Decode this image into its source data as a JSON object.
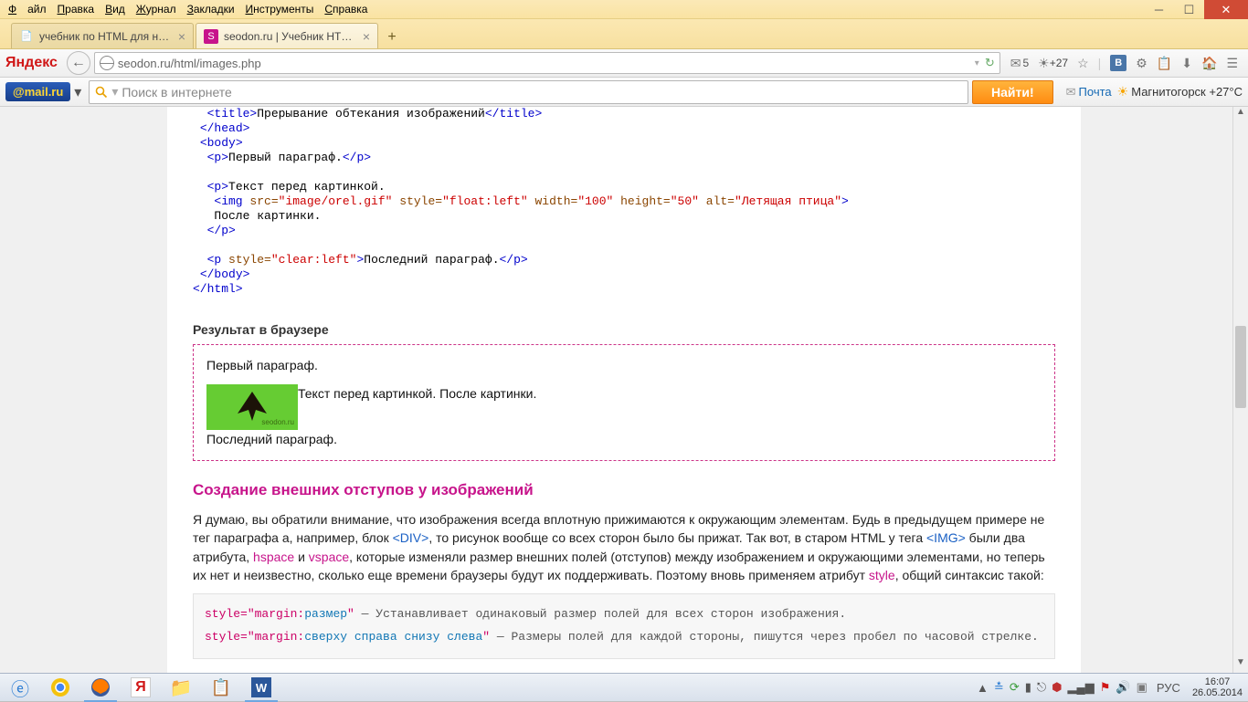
{
  "menu": {
    "file": "Файл",
    "edit": "Правка",
    "view": "Вид",
    "journal": "Журнал",
    "bookmarks": "Закладки",
    "tools": "Инструменты",
    "help": "Справка"
  },
  "tabs": [
    {
      "title": "учебник по HTML для начи...",
      "fav": "📘"
    },
    {
      "title": "seodon.ru | Учебник HTM...",
      "fav": "S"
    }
  ],
  "nav": {
    "yandex": "Яндекс",
    "url": "seodon.ru/html/images.php",
    "mailcount": "5",
    "temp": "+27"
  },
  "mailbar": {
    "logo": "@mail.ru",
    "placeholder": "Поиск в интернете",
    "button": "Найти!",
    "mail": "Почта",
    "city": "Магнитогорск +27°C"
  },
  "code": {
    "title_open": "<title>",
    "title_text": "Прерывание обтекания изображений",
    "title_close": "</title>",
    "head_close": "</head>",
    "body_open": "<body>",
    "p1_open": "<p>",
    "p1_text": "Первый параграф.",
    "p1_close": "</p>",
    "p2_open": "<p>",
    "p2_text": "Текст перед картинкой.",
    "img_open": "<img ",
    "src_a": "src=",
    "src_v": "\"image/orel.gif\"",
    "style_a": " style=",
    "style_v": "\"float:left\"",
    "width_a": " width=",
    "width_v": "\"100\"",
    "height_a": " height=",
    "height_v": "\"50\"",
    "alt_a": " alt=",
    "alt_v": "\"Летящая птица\"",
    "img_close": ">",
    "after": "После картинки.",
    "p2_close": "</p>",
    "p3_open": "<p ",
    "p3_style_a": "style=",
    "p3_style_v": "\"clear:left\"",
    "p3_gt": ">",
    "p3_text": "Последний параграф.",
    "p3_close": "</p>",
    "body_close": "</body>",
    "html_close": "</html>"
  },
  "result": {
    "heading": "Результат в браузере",
    "p1": "Первый параграф.",
    "p2": "Текст перед картинкой. После картинки.",
    "p3": "Последний параграф.",
    "sig": "seodon.ru"
  },
  "section": {
    "title": "Создание внешних отступов у изображений",
    "para1_a": "Я думаю, вы обратили внимание, что изображения всегда вплотную прижимаются к окружающим элементам. Будь в предыдущем примере не тег параграфа а, например, блок ",
    "div": "<DIV>",
    "para1_b": ", то рисунок вообще со всех сторон было бы прижат. Так вот, в старом HTML у тега ",
    "img": "<IMG>",
    "para1_c": " были два атрибута, ",
    "hspace": "hspace",
    "and": " и ",
    "vspace": "vspace",
    "para1_d": ", которые изменяли размер внешних полей (отступов) между изображением и окружающими элементами, но теперь их нет и неизвестно, сколько еще времени браузеры будут их поддерживать. Поэтому вновь применяем атрибут ",
    "style": "style",
    "para1_e": ", общий синтаксис такой:"
  },
  "syntax": {
    "s1_a": "style=",
    "s1_b": "\"margin:",
    "s1_c": "размер",
    "s1_d": "\"",
    "s1_desc": " — Устанавливает одинаковый размер полей для всех сторон изображения.",
    "s2_a": "style=",
    "s2_b": "\"margin:",
    "s2_c": "сверху справа снизу слева",
    "s2_d": "\"",
    "s2_desc": " — Размеры полей для каждой стороны, пишутся через пробел по часовой стрелке."
  },
  "tray": {
    "lang": "РУС",
    "time": "16:07",
    "date": "26.05.2014"
  }
}
